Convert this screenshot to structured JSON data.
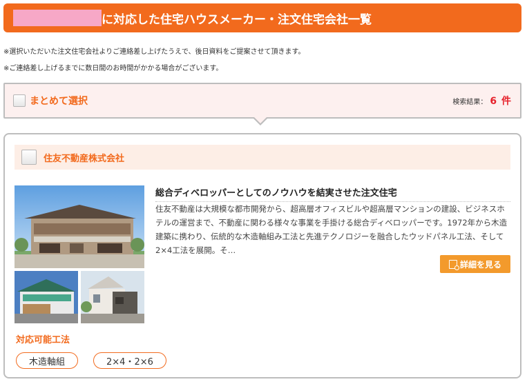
{
  "header": {
    "title": "に対応した住宅ハウスメーカー・注文住宅会社一覧"
  },
  "notes": [
    "※選択いただいた注文住宅会社よりご連絡差し上げたうえで、後日資料をご提案させて頂きます。",
    "※ご連絡差し上げるまでに数日間のお時間がかかる場合がございます。"
  ],
  "select_bar": {
    "label": "まとめて選択",
    "result_label": "検索結果：",
    "result_count": "6 件"
  },
  "card": {
    "company_name": "住友不動産株式会社",
    "catch": "総合ディベロッパーとしてのノウハウを結実させた注文住宅",
    "description": "住友不動産は大規模な都市開発から、超高層オフィスビルや超高層マンションの建設、ビジネスホテルの運営まで、不動産に関わる様々な事業を手掛ける総合ディベロッパーです。1972年から木造建築に携わり、伝統的な木造軸組み工法と先進テクノロジーを融合したウッドパネル工法、そして2×4工法を展開。そ…",
    "detail_button": "詳細を見る",
    "methods_title": "対応可能工法",
    "methods": [
      "木造軸組",
      "2×4・2×6"
    ]
  },
  "colors": {
    "accent": "#f26a1d",
    "count": "#e6202a",
    "button": "#f39a2c"
  }
}
